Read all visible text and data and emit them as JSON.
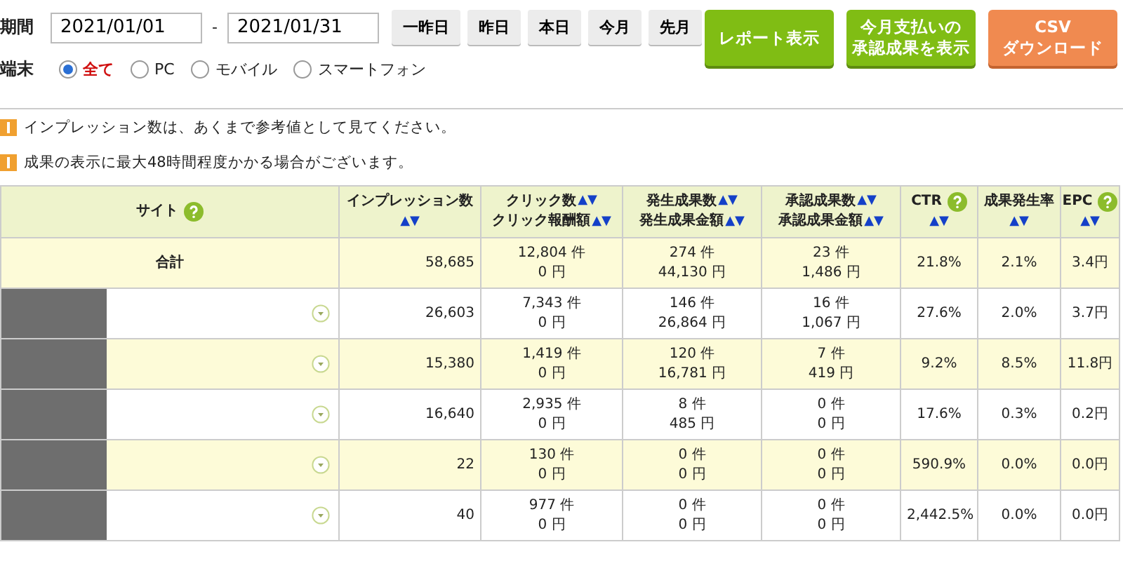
{
  "period": {
    "label": "期間",
    "from": "2021/01/01",
    "separator": "-",
    "to": "2021/01/31",
    "quick_buttons": [
      "一昨日",
      "昨日",
      "本日",
      "今月",
      "先月"
    ]
  },
  "actions": [
    {
      "kind": "report",
      "lines": [
        "レポート表示"
      ]
    },
    {
      "kind": "report",
      "lines": [
        "今月支払いの",
        "承認成果を表示"
      ]
    },
    {
      "kind": "export",
      "lines": [
        "CSV",
        "ダウンロード"
      ]
    }
  ],
  "device": {
    "label": "端末",
    "options": [
      {
        "label": "全て",
        "selected": true
      },
      {
        "label": "PC",
        "selected": false
      },
      {
        "label": "モバイル",
        "selected": false
      },
      {
        "label": "スマートフォン",
        "selected": false
      }
    ]
  },
  "notices": [
    "インプレッション数は、あくまで参考値として見てください。",
    "成果の表示に最大48時間程度かかる場合がございます。"
  ],
  "table": {
    "columns": [
      {
        "lines": [
          {
            "text": "サイト"
          }
        ],
        "help": true
      },
      {
        "lines": [
          {
            "text": "インプレッション数"
          },
          {
            "sort": "▲▼"
          }
        ],
        "help": false
      },
      {
        "lines": [
          {
            "text": "クリック数",
            "sort": "▲▼"
          },
          {
            "text": "クリック報酬額",
            "sort": "▲▼"
          }
        ],
        "help": false
      },
      {
        "lines": [
          {
            "text": "発生成果数",
            "sort": "▲▼"
          },
          {
            "text": "発生成果金額",
            "sort": "▲▼"
          }
        ],
        "help": false
      },
      {
        "lines": [
          {
            "text": "承認成果数",
            "sort": "▲▼"
          },
          {
            "text": "承認成果金額",
            "sort": "▲▼"
          }
        ],
        "help": false
      },
      {
        "lines": [
          {
            "text": "CTR"
          },
          {
            "sort": "▲▼"
          }
        ],
        "help": true
      },
      {
        "lines": [
          {
            "text": "成果発生率"
          },
          {
            "sort": "▲▼"
          }
        ],
        "help": false
      },
      {
        "lines": [
          {
            "text": "EPC"
          },
          {
            "sort": "▲▼"
          }
        ],
        "help": true
      }
    ],
    "total": {
      "label": "合計",
      "impressions": "58,685",
      "clicks": [
        "12,804 件",
        "0 円"
      ],
      "generated": [
        "274 件",
        "44,130 円"
      ],
      "approved": [
        "23 件",
        "1,486 円"
      ],
      "ctr": "21.8%",
      "rate": "2.1%",
      "epc": "3.4円"
    },
    "rows": [
      {
        "highlighted": false,
        "impressions": "26,603",
        "clicks": [
          "7,343 件",
          "0 円"
        ],
        "generated": [
          "146 件",
          "26,864 円"
        ],
        "approved": [
          "16 件",
          "1,067 円"
        ],
        "ctr": "27.6%",
        "rate": "2.0%",
        "epc": "3.7円"
      },
      {
        "highlighted": true,
        "impressions": "15,380",
        "clicks": [
          "1,419 件",
          "0 円"
        ],
        "generated": [
          "120 件",
          "16,781 円"
        ],
        "approved": [
          "7 件",
          "419 円"
        ],
        "ctr": "9.2%",
        "rate": "8.5%",
        "epc": "11.8円"
      },
      {
        "highlighted": false,
        "impressions": "16,640",
        "clicks": [
          "2,935 件",
          "0 円"
        ],
        "generated": [
          "8 件",
          "485 円"
        ],
        "approved": [
          "0 件",
          "0 円"
        ],
        "ctr": "17.6%",
        "rate": "0.3%",
        "epc": "0.2円"
      },
      {
        "highlighted": true,
        "impressions": "22",
        "clicks": [
          "130 件",
          "0 円"
        ],
        "generated": [
          "0 件",
          "0 円"
        ],
        "approved": [
          "0 件",
          "0 円"
        ],
        "ctr": "590.9%",
        "rate": "0.0%",
        "epc": "0.0円"
      },
      {
        "highlighted": false,
        "impressions": "40",
        "clicks": [
          "977 件",
          "0 円"
        ],
        "generated": [
          "0 件",
          "0 円"
        ],
        "approved": [
          "0 件",
          "0 円"
        ],
        "ctr": "2,442.5%",
        "rate": "0.0%",
        "epc": "0.0円"
      }
    ]
  }
}
